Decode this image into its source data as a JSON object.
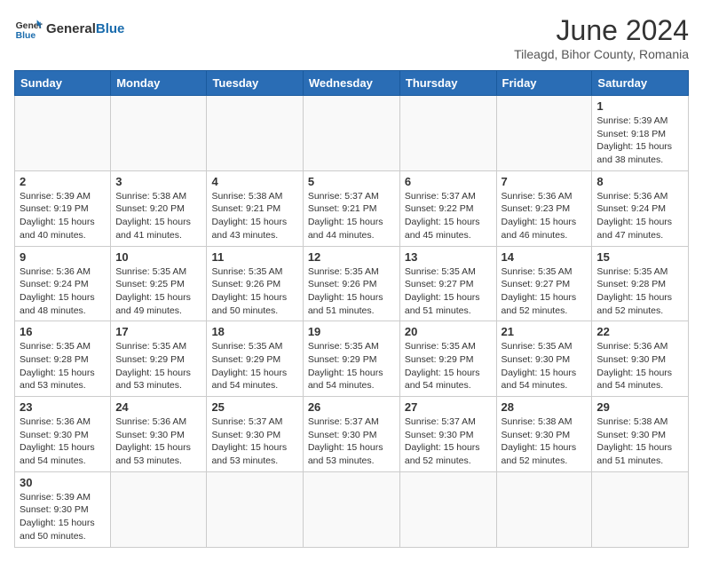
{
  "header": {
    "logo_general": "General",
    "logo_blue": "Blue",
    "month_title": "June 2024",
    "subtitle": "Tileagd, Bihor County, Romania"
  },
  "weekdays": [
    "Sunday",
    "Monday",
    "Tuesday",
    "Wednesday",
    "Thursday",
    "Friday",
    "Saturday"
  ],
  "weeks": [
    [
      {
        "day": "",
        "info": ""
      },
      {
        "day": "",
        "info": ""
      },
      {
        "day": "",
        "info": ""
      },
      {
        "day": "",
        "info": ""
      },
      {
        "day": "",
        "info": ""
      },
      {
        "day": "",
        "info": ""
      },
      {
        "day": "1",
        "info": "Sunrise: 5:39 AM\nSunset: 9:18 PM\nDaylight: 15 hours and 38 minutes."
      }
    ],
    [
      {
        "day": "2",
        "info": "Sunrise: 5:39 AM\nSunset: 9:19 PM\nDaylight: 15 hours and 40 minutes."
      },
      {
        "day": "3",
        "info": "Sunrise: 5:38 AM\nSunset: 9:20 PM\nDaylight: 15 hours and 41 minutes."
      },
      {
        "day": "4",
        "info": "Sunrise: 5:38 AM\nSunset: 9:21 PM\nDaylight: 15 hours and 43 minutes."
      },
      {
        "day": "5",
        "info": "Sunrise: 5:37 AM\nSunset: 9:21 PM\nDaylight: 15 hours and 44 minutes."
      },
      {
        "day": "6",
        "info": "Sunrise: 5:37 AM\nSunset: 9:22 PM\nDaylight: 15 hours and 45 minutes."
      },
      {
        "day": "7",
        "info": "Sunrise: 5:36 AM\nSunset: 9:23 PM\nDaylight: 15 hours and 46 minutes."
      },
      {
        "day": "8",
        "info": "Sunrise: 5:36 AM\nSunset: 9:24 PM\nDaylight: 15 hours and 47 minutes."
      }
    ],
    [
      {
        "day": "9",
        "info": "Sunrise: 5:36 AM\nSunset: 9:24 PM\nDaylight: 15 hours and 48 minutes."
      },
      {
        "day": "10",
        "info": "Sunrise: 5:35 AM\nSunset: 9:25 PM\nDaylight: 15 hours and 49 minutes."
      },
      {
        "day": "11",
        "info": "Sunrise: 5:35 AM\nSunset: 9:26 PM\nDaylight: 15 hours and 50 minutes."
      },
      {
        "day": "12",
        "info": "Sunrise: 5:35 AM\nSunset: 9:26 PM\nDaylight: 15 hours and 51 minutes."
      },
      {
        "day": "13",
        "info": "Sunrise: 5:35 AM\nSunset: 9:27 PM\nDaylight: 15 hours and 51 minutes."
      },
      {
        "day": "14",
        "info": "Sunrise: 5:35 AM\nSunset: 9:27 PM\nDaylight: 15 hours and 52 minutes."
      },
      {
        "day": "15",
        "info": "Sunrise: 5:35 AM\nSunset: 9:28 PM\nDaylight: 15 hours and 52 minutes."
      }
    ],
    [
      {
        "day": "16",
        "info": "Sunrise: 5:35 AM\nSunset: 9:28 PM\nDaylight: 15 hours and 53 minutes."
      },
      {
        "day": "17",
        "info": "Sunrise: 5:35 AM\nSunset: 9:29 PM\nDaylight: 15 hours and 53 minutes."
      },
      {
        "day": "18",
        "info": "Sunrise: 5:35 AM\nSunset: 9:29 PM\nDaylight: 15 hours and 54 minutes."
      },
      {
        "day": "19",
        "info": "Sunrise: 5:35 AM\nSunset: 9:29 PM\nDaylight: 15 hours and 54 minutes."
      },
      {
        "day": "20",
        "info": "Sunrise: 5:35 AM\nSunset: 9:29 PM\nDaylight: 15 hours and 54 minutes."
      },
      {
        "day": "21",
        "info": "Sunrise: 5:35 AM\nSunset: 9:30 PM\nDaylight: 15 hours and 54 minutes."
      },
      {
        "day": "22",
        "info": "Sunrise: 5:36 AM\nSunset: 9:30 PM\nDaylight: 15 hours and 54 minutes."
      }
    ],
    [
      {
        "day": "23",
        "info": "Sunrise: 5:36 AM\nSunset: 9:30 PM\nDaylight: 15 hours and 54 minutes."
      },
      {
        "day": "24",
        "info": "Sunrise: 5:36 AM\nSunset: 9:30 PM\nDaylight: 15 hours and 53 minutes."
      },
      {
        "day": "25",
        "info": "Sunrise: 5:37 AM\nSunset: 9:30 PM\nDaylight: 15 hours and 53 minutes."
      },
      {
        "day": "26",
        "info": "Sunrise: 5:37 AM\nSunset: 9:30 PM\nDaylight: 15 hours and 53 minutes."
      },
      {
        "day": "27",
        "info": "Sunrise: 5:37 AM\nSunset: 9:30 PM\nDaylight: 15 hours and 52 minutes."
      },
      {
        "day": "28",
        "info": "Sunrise: 5:38 AM\nSunset: 9:30 PM\nDaylight: 15 hours and 52 minutes."
      },
      {
        "day": "29",
        "info": "Sunrise: 5:38 AM\nSunset: 9:30 PM\nDaylight: 15 hours and 51 minutes."
      }
    ],
    [
      {
        "day": "30",
        "info": "Sunrise: 5:39 AM\nSunset: 9:30 PM\nDaylight: 15 hours and 50 minutes."
      },
      {
        "day": "",
        "info": ""
      },
      {
        "day": "",
        "info": ""
      },
      {
        "day": "",
        "info": ""
      },
      {
        "day": "",
        "info": ""
      },
      {
        "day": "",
        "info": ""
      },
      {
        "day": "",
        "info": ""
      }
    ]
  ]
}
